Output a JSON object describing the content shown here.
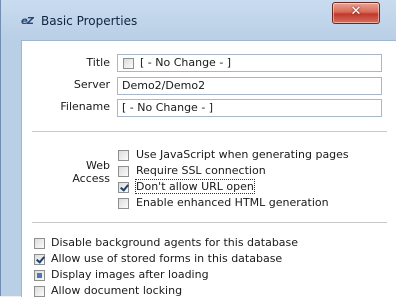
{
  "window": {
    "app_icon_text": "eZ",
    "title": "Basic Properties",
    "close_label": "✕"
  },
  "fields": {
    "title": {
      "label": "Title",
      "value": "[ - No Change - ]",
      "checked": false
    },
    "server": {
      "label": "Server",
      "value": "Demo2/Demo2"
    },
    "filename": {
      "label": "Filename",
      "value": "[ - No Change - ]"
    }
  },
  "web_access": {
    "label_line1": "Web",
    "label_line2": "Access",
    "options": [
      {
        "label": "Use JavaScript when generating pages",
        "state": "unchecked"
      },
      {
        "label": "Require SSL connection",
        "state": "unchecked"
      },
      {
        "label": "Don't allow URL open",
        "state": "checked"
      },
      {
        "label": "Enable enhanced HTML generation",
        "state": "unchecked"
      }
    ]
  },
  "database_options": [
    {
      "label": "Disable background agents for this database",
      "state": "unchecked"
    },
    {
      "label": "Allow use of stored forms in this database",
      "state": "checked"
    },
    {
      "label": "Display images after loading",
      "state": "partial"
    },
    {
      "label": "Allow document locking",
      "state": "unchecked"
    }
  ]
}
